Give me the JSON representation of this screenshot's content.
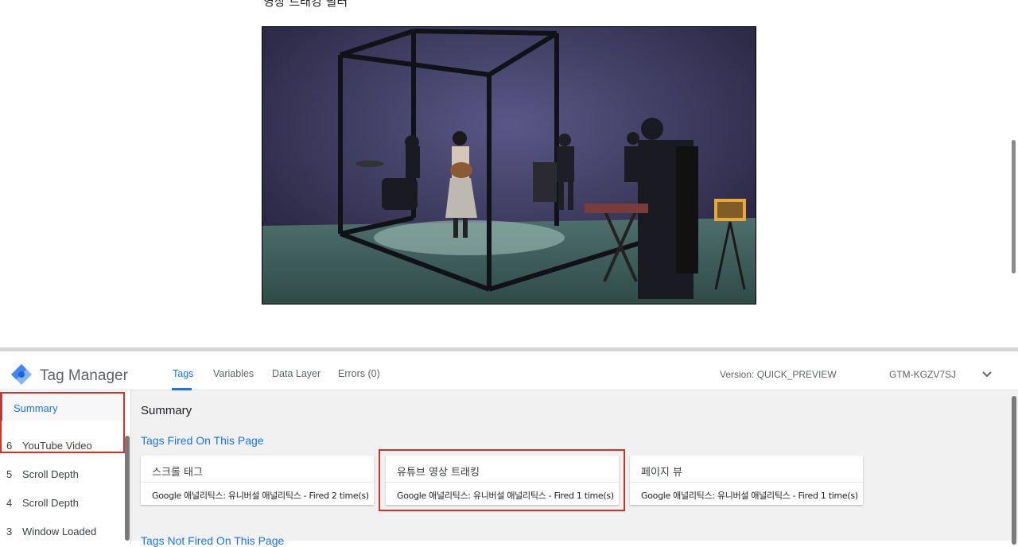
{
  "page": {
    "heading": "영상 트래킹 필터"
  },
  "gtm": {
    "title": "Tag Manager",
    "tabs": [
      {
        "label": "Tags",
        "active": true
      },
      {
        "label": "Variables",
        "active": false
      },
      {
        "label": "Data Layer",
        "active": false
      },
      {
        "label": "Errors (0)",
        "active": false
      }
    ],
    "version": "Version: QUICK_PREVIEW",
    "container_id": "GTM-KGZV7SJ",
    "accent_color": "#1a73e8",
    "highlight_color": "#d93025"
  },
  "sidebar": {
    "summary_label": "Summary",
    "events": [
      {
        "num": "6",
        "label": "YouTube Video"
      },
      {
        "num": "5",
        "label": "Scroll Depth"
      },
      {
        "num": "4",
        "label": "Scroll Depth"
      },
      {
        "num": "3",
        "label": "Window Loaded"
      }
    ]
  },
  "main": {
    "title": "Summary",
    "fired_heading": "Tags Fired On This Page",
    "not_fired_heading": "Tags Not Fired On This Page",
    "fired_tags": [
      {
        "name": "스크롤 태그",
        "detail": "Google 애널리틱스: 유니버설 애널리틱스 - Fired 2 time(s)"
      },
      {
        "name": "유튜브 영상 트래킹",
        "detail": "Google 애널리틱스: 유니버설 애널리틱스 - Fired 1 time(s)"
      },
      {
        "name": "페이지 뷰",
        "detail": "Google 애널리틱스: 유니버설 애널리틱스 - Fired 1 time(s)"
      }
    ]
  }
}
